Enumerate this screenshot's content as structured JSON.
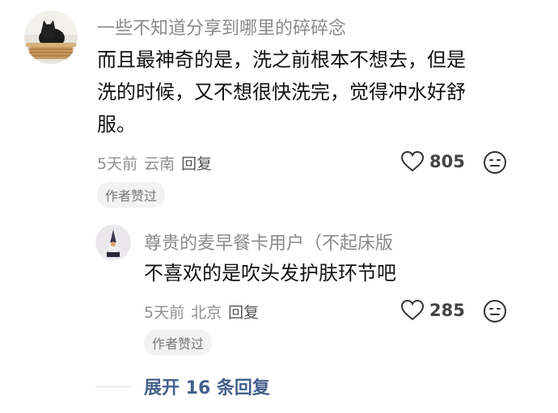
{
  "comment": {
    "username": "一些不知道分享到哪里的碎碎念",
    "lines": [
      "而且最神奇的是，洗之前根本不想去，但是",
      "洗的时候，又不想很快洗完，觉得冲水好舒",
      "服。"
    ],
    "time": "5天前",
    "location": "云南",
    "reply_label": "回复",
    "likes": "805",
    "badge": "作者赞过"
  },
  "reply": {
    "username": "尊贵的麦早餐卡用户（不起床版",
    "text": "不喜欢的是吹头发护肤环节吧",
    "time": "5天前",
    "location": "北京",
    "reply_label": "回复",
    "likes": "285",
    "badge": "作者赞过"
  },
  "expand_label": "展开 16 条回复",
  "icons": {
    "like": "heart-icon",
    "reaction": "meh-face-icon"
  },
  "colors": {
    "expand_link": "#44608c",
    "username": "#8a8a8a"
  }
}
